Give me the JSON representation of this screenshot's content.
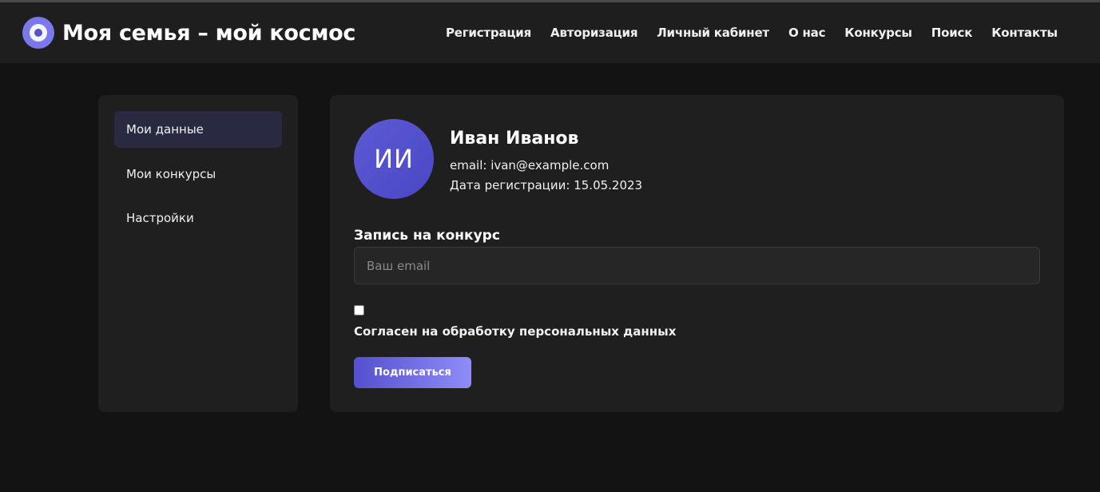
{
  "header": {
    "title": "Моя семья – мой космос",
    "nav": [
      "Регистрация",
      "Авторизация",
      "Личный кабинет",
      "О нас",
      "Конкурсы",
      "Поиск",
      "Контакты"
    ]
  },
  "sidebar": {
    "items": [
      {
        "label": "Мои данные",
        "active": true
      },
      {
        "label": "Мои конкурсы",
        "active": false
      },
      {
        "label": "Настройки",
        "active": false
      }
    ]
  },
  "profile": {
    "initials": "ИИ",
    "name": "Иван Иванов",
    "email": "email: ivan@example.com",
    "registered": "Дата регистрации: 15.05.2023"
  },
  "contest_form": {
    "title": "Запись на конкурс",
    "email_value": "",
    "email_placeholder": "Ваш email",
    "consent_label": "Согласен на обработку персональных данных",
    "consent_checked": false,
    "submit_label": "Подписаться"
  },
  "colors": {
    "background": "#131313",
    "header": "#1e1e1e",
    "panel": "#1f1f1f",
    "accent": "#5450cf",
    "accent_light": "#8f8df8",
    "active_item": "#2a2942"
  },
  "icons": {
    "logo": "planet-logo-icon"
  }
}
